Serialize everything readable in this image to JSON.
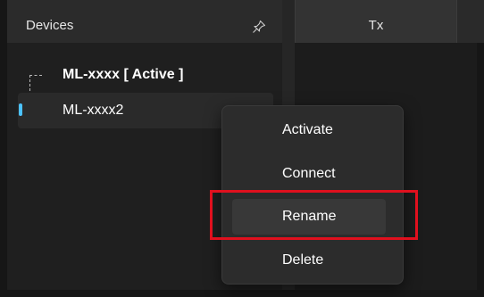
{
  "devices_panel": {
    "title": "Devices",
    "pin_icon": "pin-icon",
    "items": [
      {
        "label": "ML-xxxx [ Active ]"
      },
      {
        "label": "ML-xxxx2"
      }
    ]
  },
  "tabs": [
    {
      "label": "Tx"
    }
  ],
  "context_menu": {
    "items": [
      {
        "label": "Activate"
      },
      {
        "label": "Connect"
      },
      {
        "label": "Rename"
      },
      {
        "label": "Delete"
      }
    ]
  },
  "colors": {
    "accent": "#4cc2ff",
    "highlight": "#e0101e"
  }
}
